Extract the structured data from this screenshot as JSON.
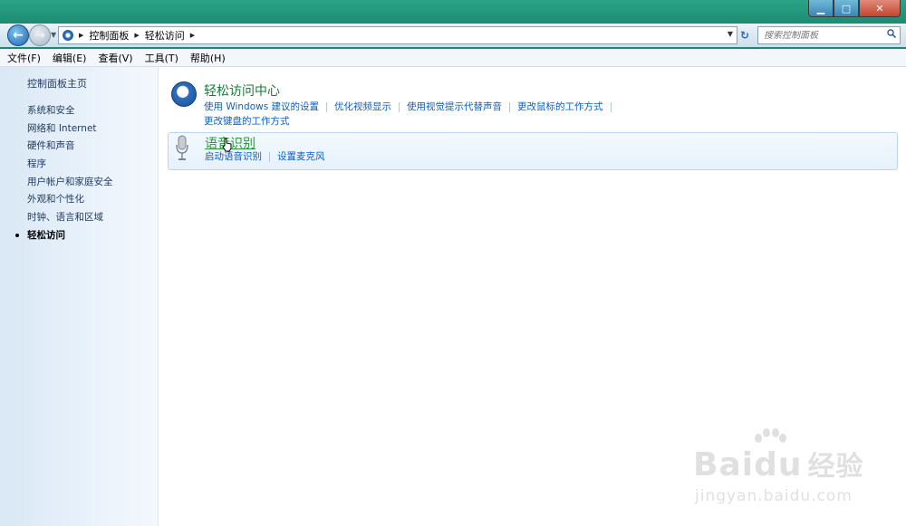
{
  "window": {
    "controls": {
      "minimize": "▁",
      "maximize": "□",
      "close": "✕"
    }
  },
  "nav": {
    "breadcrumb": [
      "控制面板",
      "轻松访问"
    ],
    "search_placeholder": "搜索控制面板"
  },
  "menubar": {
    "items": [
      "文件(F)",
      "编辑(E)",
      "查看(V)",
      "工具(T)",
      "帮助(H)"
    ]
  },
  "sidebar": {
    "home": "控制面板主页",
    "items": [
      {
        "label": "系统和安全"
      },
      {
        "label": "网络和 Internet"
      },
      {
        "label": "硬件和声音"
      },
      {
        "label": "程序"
      },
      {
        "label": "用户帐户和家庭安全"
      },
      {
        "label": "外观和个性化"
      },
      {
        "label": "时钟、语言和区域"
      },
      {
        "label": "轻松访问",
        "current": true
      }
    ]
  },
  "main": {
    "categories": [
      {
        "title": "轻松访问中心",
        "icon": "ease-of-access-icon",
        "links": [
          "使用 Windows 建议的设置",
          "优化视频显示",
          "使用视觉提示代替声音",
          "更改鼠标的工作方式",
          "更改键盘的工作方式"
        ]
      },
      {
        "title": "语音识别",
        "icon": "microphone-icon",
        "highlighted": true,
        "links": [
          "启动语音识别",
          "设置麦克风"
        ]
      }
    ]
  },
  "watermark": {
    "logo_latin": "Bai",
    "logo_mid": "du",
    "logo_cn": "经验",
    "url": "jingyan.baidu.com"
  },
  "colors": {
    "title_bar": "#1b8a6f",
    "link": "#0d5fbd",
    "category_title": "#1e7a3a"
  }
}
